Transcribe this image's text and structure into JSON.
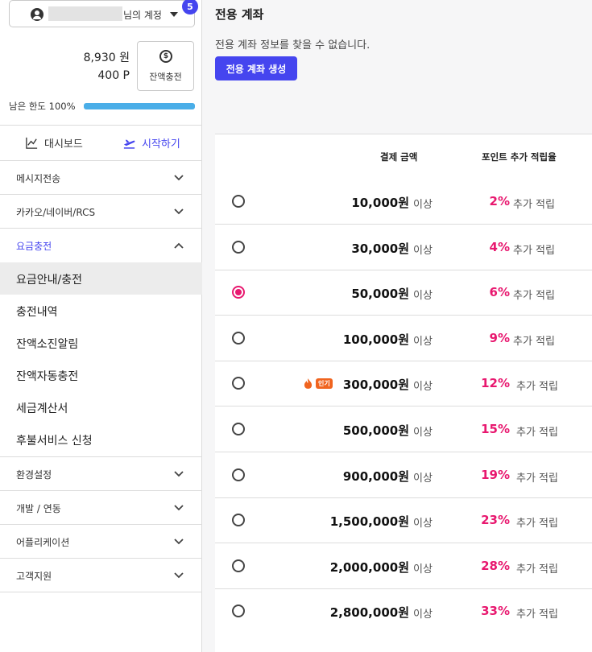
{
  "account": {
    "suffix_label": "님의 계정",
    "notification_count": "5"
  },
  "balance": {
    "won": "8,930 원",
    "points": "400 P",
    "charge_button_label": "잔액충전",
    "limit_label": "남은 한도 100%",
    "limit_fraction": 1.0
  },
  "quick_links": {
    "dashboard_label": "대시보드",
    "start_label": "시작하기"
  },
  "menu": {
    "sections": [
      {
        "label": "메시지전송",
        "expanded": false
      },
      {
        "label": "카카오/네이버/RCS",
        "expanded": false
      },
      {
        "label": "요금충전",
        "expanded": true
      },
      {
        "label": "환경설정",
        "expanded": false
      },
      {
        "label": "개발 / 연동",
        "expanded": false
      },
      {
        "label": "어플리케이션",
        "expanded": false
      },
      {
        "label": "고객지원",
        "expanded": false
      }
    ],
    "charge_subitems": [
      {
        "label": "요금안내/충전",
        "selected": true
      },
      {
        "label": "충전내역",
        "selected": false
      },
      {
        "label": "잔액소진알림",
        "selected": false
      },
      {
        "label": "잔액자동충전",
        "selected": false
      },
      {
        "label": "세금계산서",
        "selected": false
      },
      {
        "label": "후불서비스 신청",
        "selected": false
      }
    ]
  },
  "main": {
    "title": "전용 계좌",
    "message": "전용 계좌 정보를 찾을 수 없습니다.",
    "create_button_label": "전용 계좌 생성"
  },
  "table": {
    "header_amount": "결제 금액",
    "header_rate": "포인트 추가 적립율",
    "amount_suffix": "이상",
    "rate_suffix": "추가 적립",
    "popular_badge": "인기",
    "rows": [
      {
        "amount": "10,000원",
        "rate": "2%",
        "selected": false,
        "popular": false
      },
      {
        "amount": "30,000원",
        "rate": "4%",
        "selected": false,
        "popular": false
      },
      {
        "amount": "50,000원",
        "rate": "6%",
        "selected": true,
        "popular": false
      },
      {
        "amount": "100,000원",
        "rate": "9%",
        "selected": false,
        "popular": false
      },
      {
        "amount": "300,000원",
        "rate": "12%",
        "selected": false,
        "popular": true
      },
      {
        "amount": "500,000원",
        "rate": "15%",
        "selected": false,
        "popular": false
      },
      {
        "amount": "900,000원",
        "rate": "19%",
        "selected": false,
        "popular": false
      },
      {
        "amount": "1,500,000원",
        "rate": "23%",
        "selected": false,
        "popular": false
      },
      {
        "amount": "2,000,000원",
        "rate": "28%",
        "selected": false,
        "popular": false
      },
      {
        "amount": "2,800,000원",
        "rate": "33%",
        "selected": false,
        "popular": false
      }
    ]
  },
  "colors": {
    "accent": "#4545ef",
    "highlight": "#e8186f",
    "limit_bar": "#4aaee8",
    "popular_badge": "#f0641f"
  }
}
